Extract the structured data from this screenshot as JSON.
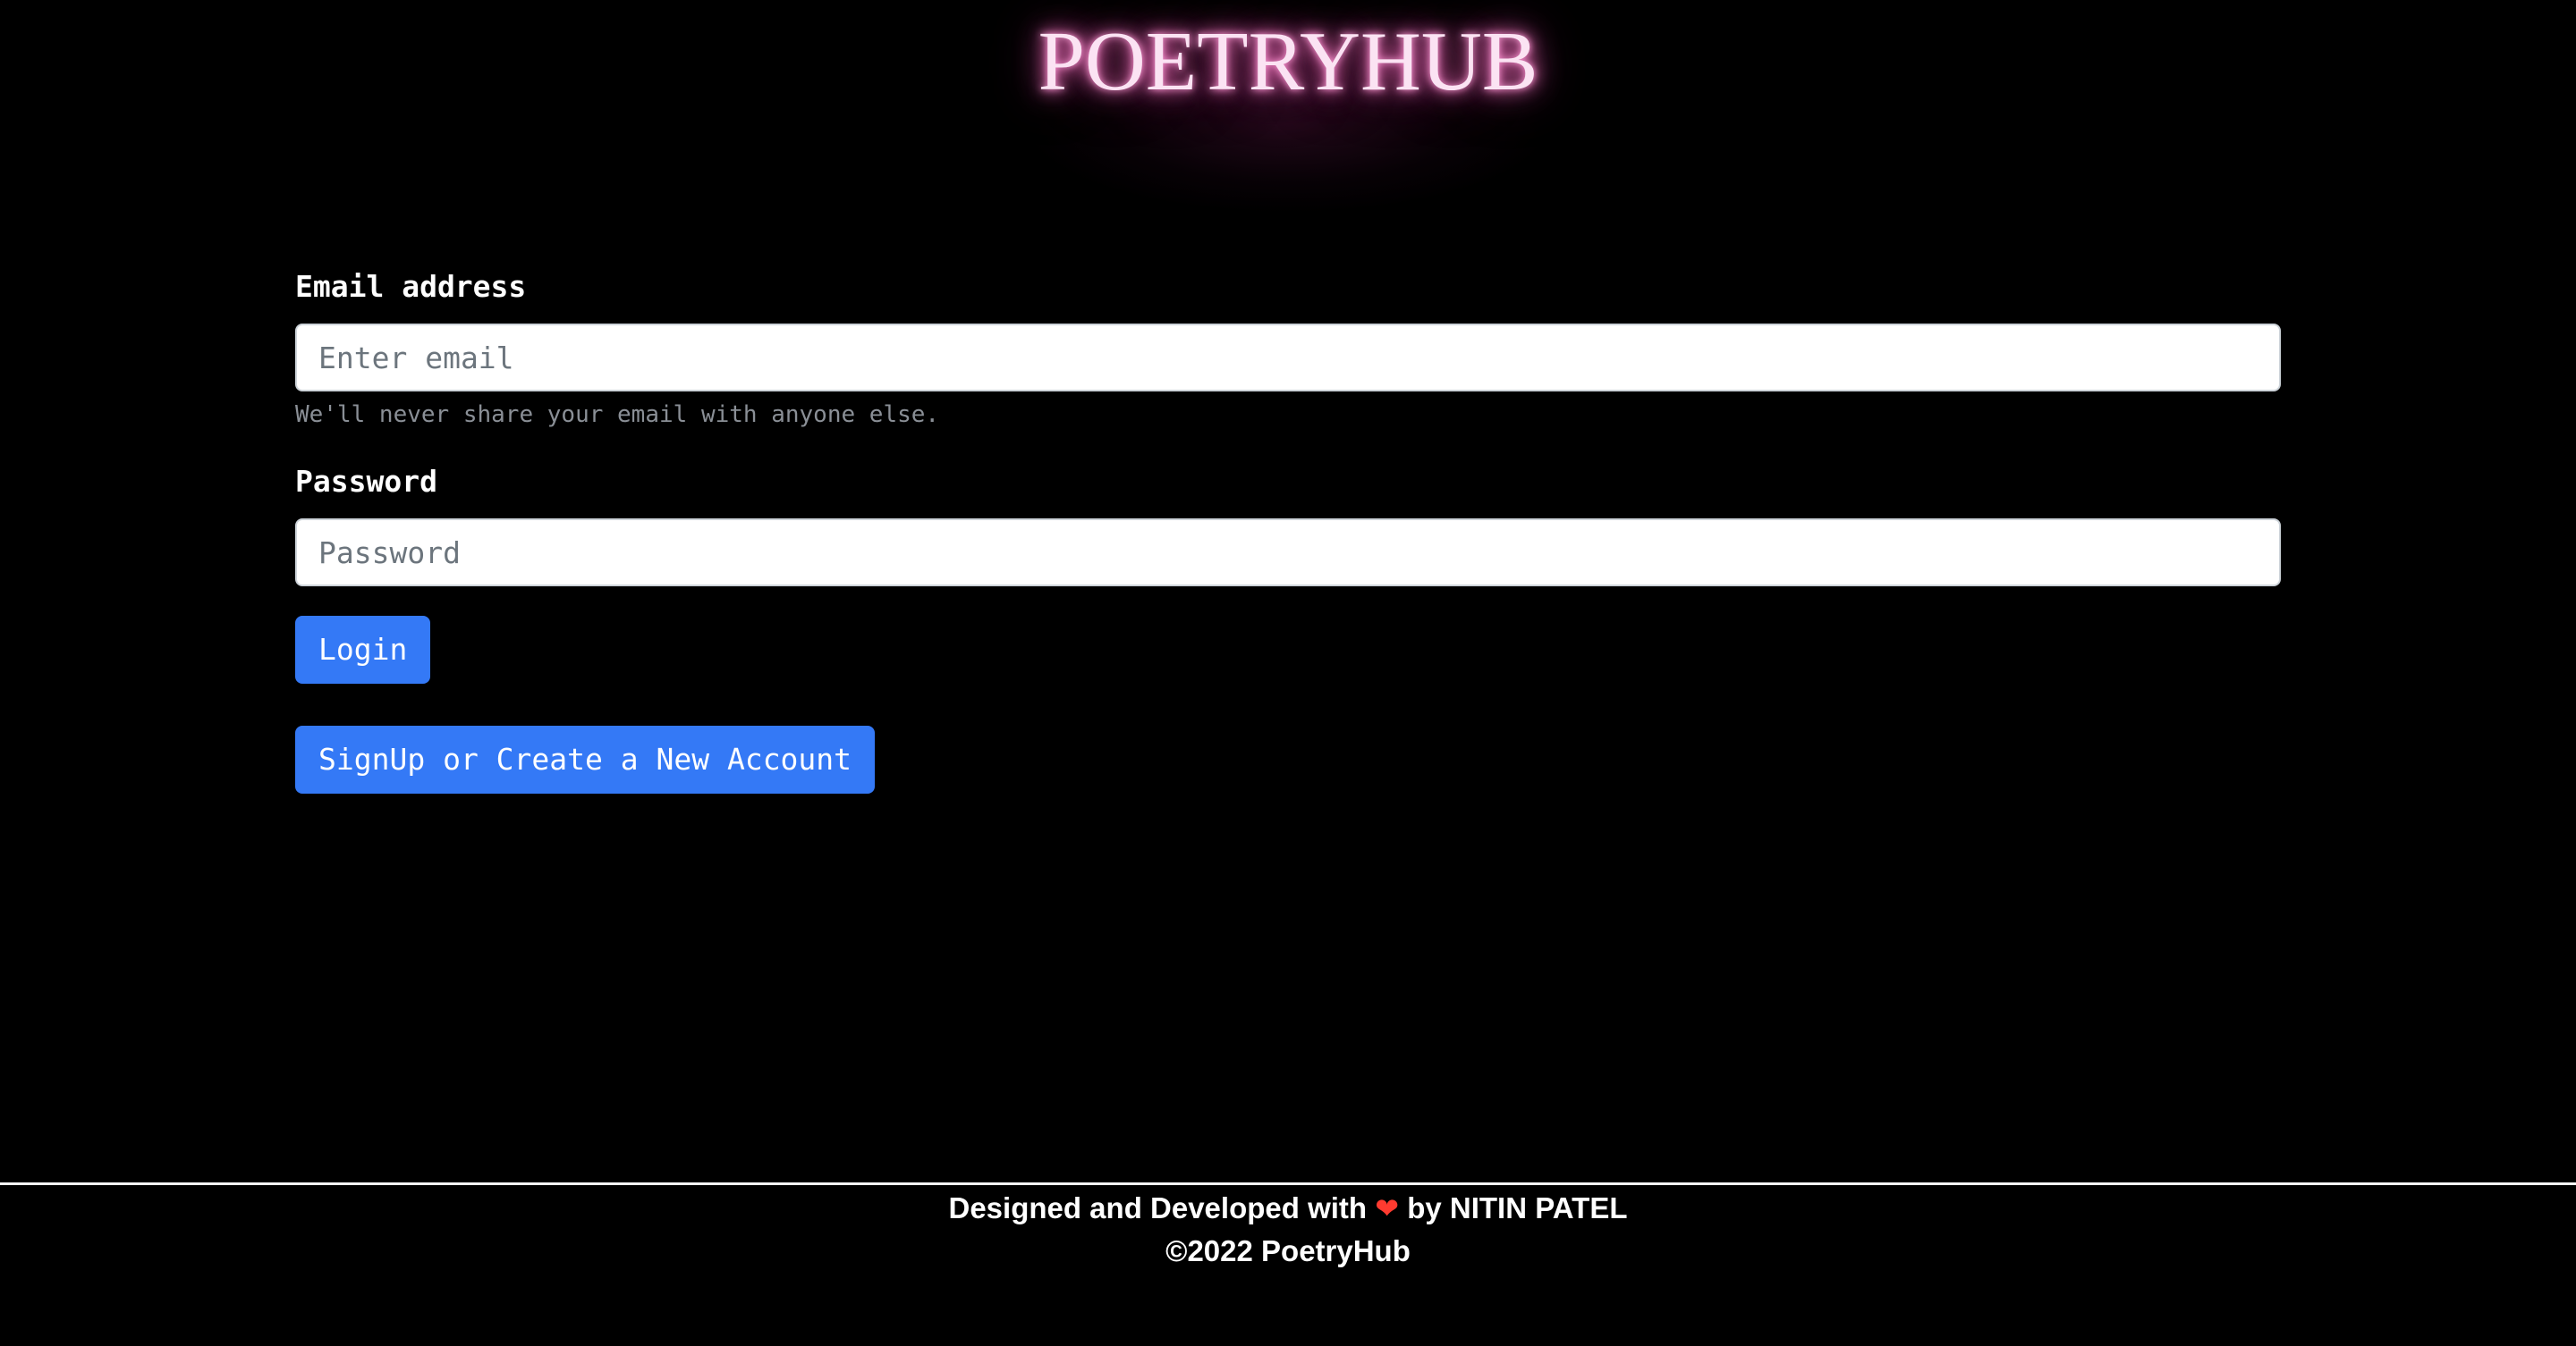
{
  "header": {
    "brand": "POETRYHUB"
  },
  "login_form": {
    "email_label": "Email address",
    "email_placeholder": "Enter email",
    "email_value": "",
    "email_help": "We'll never share your email with anyone else.",
    "password_label": "Password",
    "password_placeholder": "Password",
    "password_value": "",
    "login_button": "Login",
    "signup_button": "SignUp or Create a New Account"
  },
  "footer": {
    "credit_prefix": "Designed and Developed with",
    "heart_glyph": "❤",
    "credit_suffix": "by NITIN PATEL",
    "copyright": "©2022 PoetryHub"
  },
  "colors": {
    "background": "#000000",
    "brand_text": "#fbe3f3",
    "brand_glow": "#ff7cc8",
    "button": "#3479f6",
    "heart": "#ff3b30"
  },
  "icons": {
    "heart": "heart-icon"
  }
}
